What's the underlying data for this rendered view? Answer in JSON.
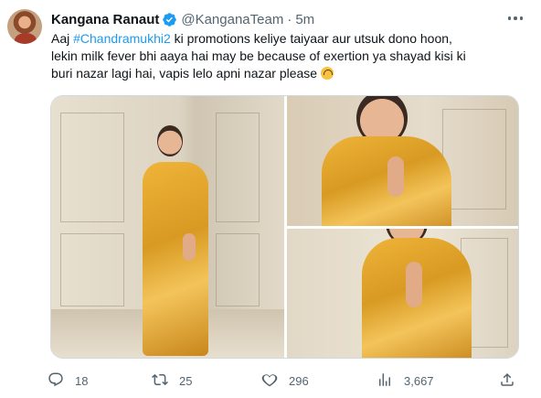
{
  "tweet": {
    "author_name": "Kangana Ranaut",
    "handle": "@KanganaTeam",
    "separator": "·",
    "time": "5m",
    "text_line1_a": "Aaj ",
    "hashtag": "#Chandramukhi2",
    "text_line1_b": " ki promotions keliye taiyaar aur utsuk dono hoon,",
    "text_line2": "lekin milk fever bhi aaya hai may be because of exertion ya shayad kisi ki",
    "text_line3": "buri nazar lagi hai, vapis lelo apni nazar please ",
    "emoji": "upside-down-face-emoji"
  },
  "actions": {
    "reply_count": "18",
    "retweet_count": "25",
    "like_count": "296",
    "views_count": "3,667"
  },
  "icons": {
    "verified": "verified-badge-icon",
    "more": "more-icon",
    "reply": "reply-icon",
    "retweet": "retweet-icon",
    "like": "heart-icon",
    "views": "views-icon",
    "share": "share-icon"
  },
  "colors": {
    "accent": "#1d9bf0",
    "text": "#0f1419",
    "muted": "#536471",
    "border": "#cfd9de",
    "saree": "#e0a52c"
  }
}
